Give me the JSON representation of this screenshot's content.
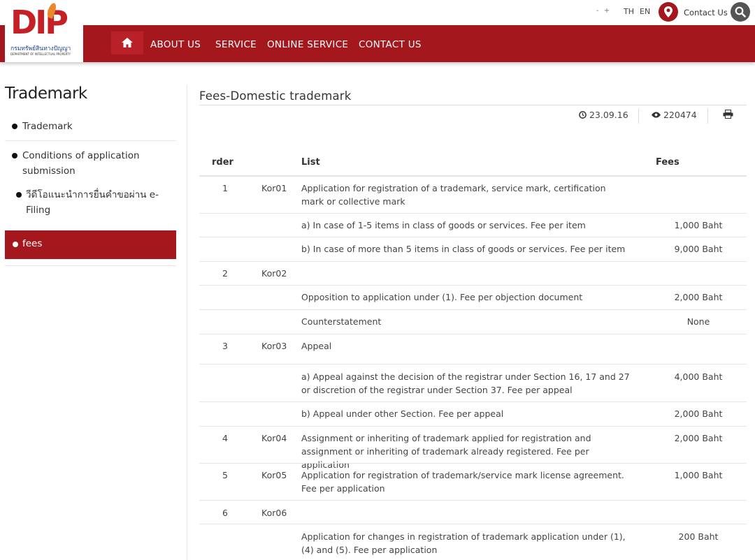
{
  "header": {
    "font_size_controls": "- +",
    "lang_th": "TH",
    "lang_en": "EN",
    "contact_label": "Contact Us"
  },
  "logo": {
    "text": "DIP",
    "thai_name": "กรมทรัพย์สินทางปัญญา",
    "english_name": "DEPARTMENT OF INTELLECTUAL PROPERTY"
  },
  "nav": {
    "items": [
      "ABOUT US",
      "SERVICE",
      "ONLINE SERVICE",
      "CONTACT US"
    ]
  },
  "sidebar": {
    "title": "Trademark",
    "items": [
      {
        "label": "Trademark"
      },
      {
        "label": "Conditions of application submission"
      },
      {
        "label": "วีดีโอแนะนำการยื่นคำขอผ่าน e-Filing"
      },
      {
        "label": "fees"
      }
    ]
  },
  "article": {
    "title": "Fees-Domestic trademark",
    "date": "23.09.16",
    "views": "220474"
  },
  "table": {
    "headers": {
      "order": "rder",
      "list": "List",
      "fees": "Fees"
    },
    "rows": [
      {
        "order": "1",
        "code": "Kor01",
        "list": "Application for registration of a trademark, service mark, certification mark or collective mark",
        "fee": ""
      },
      {
        "order": "",
        "code": "",
        "list": "a) In case of 1-5 items in class of goods or services. Fee per item",
        "fee": "1,000 Baht"
      },
      {
        "order": "",
        "code": "",
        "list": "b) In case of more than 5 items in class of goods or services. Fee per item",
        "fee": "9,000 Baht"
      },
      {
        "order": "2",
        "code": "Kor02",
        "list": "",
        "fee": ""
      },
      {
        "order": "",
        "code": "",
        "list": "Opposition to application under  (1). Fee per objection document",
        "fee": "2,000 Baht"
      },
      {
        "order": "",
        "code": "",
        "list": "Counterstatement",
        "fee": "None"
      },
      {
        "order": "3",
        "code": "Kor03",
        "list": "Appeal",
        "fee": ""
      },
      {
        "order": "",
        "code": "",
        "list": "a) Appeal against the decision of the registrar under Section 16, 17 and 27 or discretion of the registrar under Section 37. Fee per appeal",
        "fee": "4,000 Baht"
      },
      {
        "order": "",
        "code": "",
        "list": "b) Appeal under other Section. Fee per appeal",
        "fee": "2,000 Baht"
      },
      {
        "order": "4",
        "code": "Kor04",
        "list": "Assignment or inheriting of trademark applied for registration and assignment or inheriting of trademark already registered. Fee per application",
        "fee": "2,000 Baht"
      },
      {
        "order": "5",
        "code": "Kor05",
        "list": "Application for registration of trademark/service mark license agreement. Fee per application",
        "fee": "1,000 Baht"
      },
      {
        "order": "6",
        "code": "Kor06",
        "list": "",
        "fee": ""
      },
      {
        "order": "",
        "code": "",
        "list": "Application for changes in registration of trademark application under (1), (4) and (5). Fee per application",
        "fee": "200 Baht"
      }
    ]
  }
}
